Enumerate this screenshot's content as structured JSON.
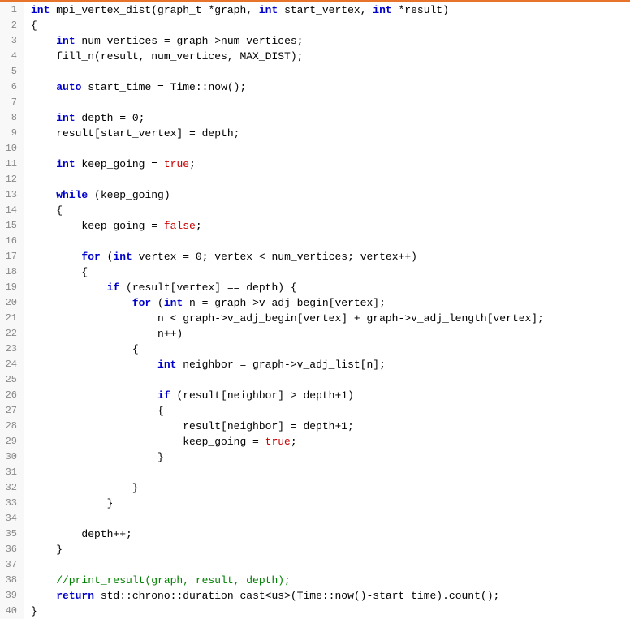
{
  "lines": [
    {
      "num": 1,
      "tokens": [
        {
          "t": "kw",
          "v": "int"
        },
        {
          "t": "plain",
          "v": " mpi_vertex_dist(graph_t *graph, "
        },
        {
          "t": "kw",
          "v": "int"
        },
        {
          "t": "plain",
          "v": " start_vertex, "
        },
        {
          "t": "kw",
          "v": "int"
        },
        {
          "t": "plain",
          "v": " *result)"
        }
      ]
    },
    {
      "num": 2,
      "tokens": [
        {
          "t": "plain",
          "v": "{"
        }
      ]
    },
    {
      "num": 3,
      "tokens": [
        {
          "t": "plain",
          "v": "    "
        },
        {
          "t": "kw",
          "v": "int"
        },
        {
          "t": "plain",
          "v": " num_vertices = graph->num_vertices;"
        }
      ]
    },
    {
      "num": 4,
      "tokens": [
        {
          "t": "plain",
          "v": "    fill_n(result, num_vertices, MAX_DIST);"
        }
      ]
    },
    {
      "num": 5,
      "tokens": [
        {
          "t": "plain",
          "v": ""
        }
      ]
    },
    {
      "num": 6,
      "tokens": [
        {
          "t": "plain",
          "v": "    "
        },
        {
          "t": "kw",
          "v": "auto"
        },
        {
          "t": "plain",
          "v": " start_time = Time::now();"
        }
      ]
    },
    {
      "num": 7,
      "tokens": [
        {
          "t": "plain",
          "v": ""
        }
      ]
    },
    {
      "num": 8,
      "tokens": [
        {
          "t": "plain",
          "v": "    "
        },
        {
          "t": "kw",
          "v": "int"
        },
        {
          "t": "plain",
          "v": " depth = "
        },
        {
          "t": "num",
          "v": "0"
        },
        {
          "t": "plain",
          "v": ";"
        }
      ]
    },
    {
      "num": 9,
      "tokens": [
        {
          "t": "plain",
          "v": "    result[start_vertex] = depth;"
        }
      ]
    },
    {
      "num": 10,
      "tokens": [
        {
          "t": "plain",
          "v": ""
        }
      ]
    },
    {
      "num": 11,
      "tokens": [
        {
          "t": "plain",
          "v": "    "
        },
        {
          "t": "kw",
          "v": "int"
        },
        {
          "t": "plain",
          "v": " keep_going = "
        },
        {
          "t": "bool-val",
          "v": "true"
        },
        {
          "t": "plain",
          "v": ";"
        }
      ]
    },
    {
      "num": 12,
      "tokens": [
        {
          "t": "plain",
          "v": ""
        }
      ]
    },
    {
      "num": 13,
      "tokens": [
        {
          "t": "plain",
          "v": "    "
        },
        {
          "t": "kw",
          "v": "while"
        },
        {
          "t": "plain",
          "v": " (keep_going)"
        }
      ]
    },
    {
      "num": 14,
      "tokens": [
        {
          "t": "plain",
          "v": "    {"
        }
      ]
    },
    {
      "num": 15,
      "tokens": [
        {
          "t": "plain",
          "v": "        keep_going = "
        },
        {
          "t": "bool-val",
          "v": "false"
        },
        {
          "t": "plain",
          "v": ";"
        }
      ]
    },
    {
      "num": 16,
      "tokens": [
        {
          "t": "plain",
          "v": ""
        }
      ]
    },
    {
      "num": 17,
      "tokens": [
        {
          "t": "plain",
          "v": "        "
        },
        {
          "t": "kw",
          "v": "for"
        },
        {
          "t": "plain",
          "v": " ("
        },
        {
          "t": "kw",
          "v": "int"
        },
        {
          "t": "plain",
          "v": " vertex = "
        },
        {
          "t": "num",
          "v": "0"
        },
        {
          "t": "plain",
          "v": "; vertex < num_vertices; vertex++)"
        }
      ]
    },
    {
      "num": 18,
      "tokens": [
        {
          "t": "plain",
          "v": "        {"
        }
      ]
    },
    {
      "num": 19,
      "tokens": [
        {
          "t": "plain",
          "v": "            "
        },
        {
          "t": "kw",
          "v": "if"
        },
        {
          "t": "plain",
          "v": " (result[vertex] == depth) {"
        }
      ]
    },
    {
      "num": 20,
      "tokens": [
        {
          "t": "plain",
          "v": "                "
        },
        {
          "t": "kw",
          "v": "for"
        },
        {
          "t": "plain",
          "v": " ("
        },
        {
          "t": "kw",
          "v": "int"
        },
        {
          "t": "plain",
          "v": " n = graph->v_adj_begin[vertex];"
        }
      ]
    },
    {
      "num": 21,
      "tokens": [
        {
          "t": "plain",
          "v": "                    n < graph->v_adj_begin[vertex] + graph->v_adj_length[vertex];"
        }
      ]
    },
    {
      "num": 22,
      "tokens": [
        {
          "t": "plain",
          "v": "                    n++)"
        }
      ]
    },
    {
      "num": 23,
      "tokens": [
        {
          "t": "plain",
          "v": "                {"
        }
      ]
    },
    {
      "num": 24,
      "tokens": [
        {
          "t": "plain",
          "v": "                    "
        },
        {
          "t": "kw",
          "v": "int"
        },
        {
          "t": "plain",
          "v": " neighbor = graph->v_adj_list[n];"
        }
      ]
    },
    {
      "num": 25,
      "tokens": [
        {
          "t": "plain",
          "v": ""
        }
      ]
    },
    {
      "num": 26,
      "tokens": [
        {
          "t": "plain",
          "v": "                    "
        },
        {
          "t": "kw",
          "v": "if"
        },
        {
          "t": "plain",
          "v": " (result[neighbor] > depth+"
        },
        {
          "t": "num",
          "v": "1"
        },
        {
          "t": "plain",
          "v": ")"
        }
      ]
    },
    {
      "num": 27,
      "tokens": [
        {
          "t": "plain",
          "v": "                    {"
        }
      ]
    },
    {
      "num": 28,
      "tokens": [
        {
          "t": "plain",
          "v": "                        result[neighbor] = depth+"
        },
        {
          "t": "num",
          "v": "1"
        },
        {
          "t": "plain",
          "v": ";"
        }
      ]
    },
    {
      "num": 29,
      "tokens": [
        {
          "t": "plain",
          "v": "                        keep_going = "
        },
        {
          "t": "bool-val",
          "v": "true"
        },
        {
          "t": "plain",
          "v": ";"
        }
      ]
    },
    {
      "num": 30,
      "tokens": [
        {
          "t": "plain",
          "v": "                    }"
        }
      ]
    },
    {
      "num": 31,
      "tokens": [
        {
          "t": "plain",
          "v": ""
        }
      ]
    },
    {
      "num": 32,
      "tokens": [
        {
          "t": "plain",
          "v": "                }"
        }
      ]
    },
    {
      "num": 33,
      "tokens": [
        {
          "t": "plain",
          "v": "            }"
        }
      ]
    },
    {
      "num": 34,
      "tokens": [
        {
          "t": "plain",
          "v": ""
        }
      ]
    },
    {
      "num": 35,
      "tokens": [
        {
          "t": "plain",
          "v": "        depth++;"
        }
      ]
    },
    {
      "num": 36,
      "tokens": [
        {
          "t": "plain",
          "v": "    }"
        }
      ]
    },
    {
      "num": 37,
      "tokens": [
        {
          "t": "plain",
          "v": ""
        }
      ]
    },
    {
      "num": 38,
      "tokens": [
        {
          "t": "comment",
          "v": "    //print_result(graph, result, depth);"
        }
      ]
    },
    {
      "num": 39,
      "tokens": [
        {
          "t": "plain",
          "v": "    "
        },
        {
          "t": "kw",
          "v": "return"
        },
        {
          "t": "plain",
          "v": " std::chrono::duration_cast<us>(Time::now()-start_time).count();"
        }
      ]
    },
    {
      "num": 40,
      "tokens": [
        {
          "t": "plain",
          "v": "}"
        }
      ]
    }
  ]
}
